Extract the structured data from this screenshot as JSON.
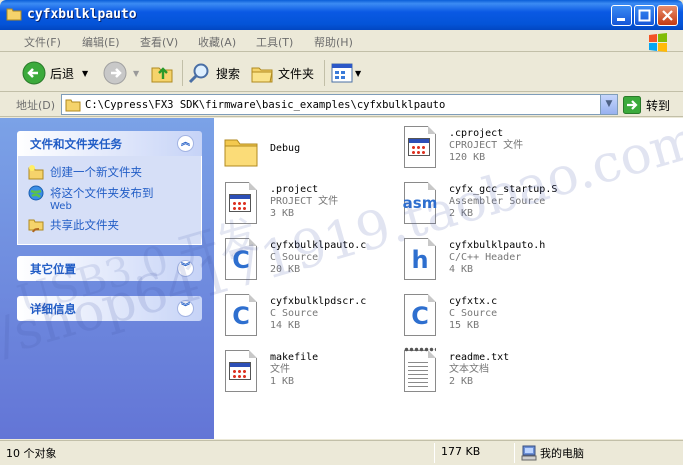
{
  "window": {
    "title": "cyfxbulklpauto"
  },
  "menu": [
    "文件(F)",
    "编辑(E)",
    "查看(V)",
    "收藏(A)",
    "工具(T)",
    "帮助(H)"
  ],
  "toolbar": {
    "back": "后退",
    "search": "搜索",
    "folders": "文件夹"
  },
  "address": {
    "label": "地址(D)",
    "path": "C:\\Cypress\\FX3 SDK\\firmware\\basic_examples\\cyfxbulklpauto",
    "go": "转到"
  },
  "tasks": {
    "title": "文件和文件夹任务",
    "items": [
      {
        "label": "创建一个新文件夹",
        "sub": ""
      },
      {
        "label": "将这个文件夹发布到",
        "sub": "Web"
      },
      {
        "label": "共享此文件夹",
        "sub": ""
      }
    ]
  },
  "other_places": {
    "title": "其它位置"
  },
  "details": {
    "title": "详细信息"
  },
  "files": [
    {
      "name": "Debug",
      "desc": "",
      "size": "",
      "icon": "folder-icon"
    },
    {
      "name": ".cproject",
      "desc": "CPROJECT 文件",
      "size": "120 KB",
      "icon": "app-file-icon"
    },
    {
      "name": ".project",
      "desc": "PROJECT 文件",
      "size": "3 KB",
      "icon": "app-file-icon"
    },
    {
      "name": "cyfx_gcc_startup.S",
      "desc": "Assembler Source",
      "size": "2 KB",
      "icon": "asm-file-icon"
    },
    {
      "name": "cyfxbulklpauto.c",
      "desc": "C Source",
      "size": "20 KB",
      "icon": "c-file-icon"
    },
    {
      "name": "cyfxbulklpauto.h",
      "desc": "C/C++ Header",
      "size": "4 KB",
      "icon": "h-file-icon"
    },
    {
      "name": "cyfxbulklpdscr.c",
      "desc": "C Source",
      "size": "14 KB",
      "icon": "c-file-icon"
    },
    {
      "name": "cyfxtx.c",
      "desc": "C Source",
      "size": "15 KB",
      "icon": "c-file-icon"
    },
    {
      "name": "makefile",
      "desc": "文件",
      "size": "1 KB",
      "icon": "app-file-icon"
    },
    {
      "name": "readme.txt",
      "desc": "文本文档",
      "size": "2 KB",
      "icon": "text-file-icon"
    }
  ],
  "watermark": {
    "line1": "USB3.0 开发",
    "line2": "/shop64171919.taobao.com"
  },
  "status": {
    "count": "10 个对象",
    "size": "177 KB",
    "location": "我的电脑"
  },
  "colors": {
    "titlebar": "#0454d8",
    "pane": "#6375d6",
    "link": "#215dc6"
  }
}
